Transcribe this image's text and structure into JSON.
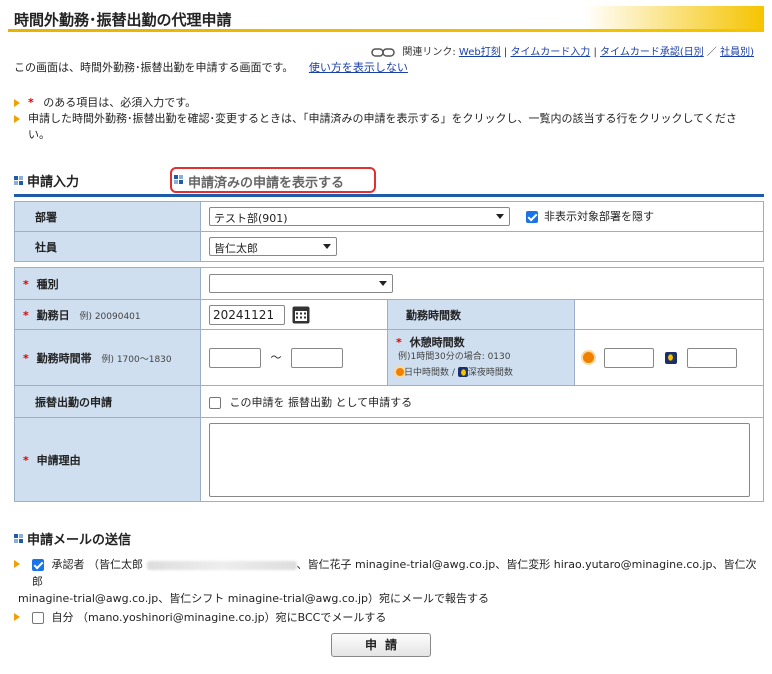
{
  "page": {
    "title": "時間外勤務･振替出勤の代理申請",
    "links_label": "関連リンク:",
    "links": [
      "Web打刻",
      "タイムカード入力",
      "タイムカード承認(日別",
      "社員別)"
    ],
    "intro": "この画面は、時間外勤務･振替出勤を申請する画面です。",
    "help_link": "使い方を表示しない",
    "note1_mark": "*",
    "note1": "のある項目は、必須入力です。",
    "note2": "申請した時間外勤務･振替出勤を確認･変更するときは、「申請済みの申請を表示する」をクリックし、一覧内の該当する行をクリックしてください。"
  },
  "tabs": {
    "input": "申請入力",
    "show_submitted": "申請済みの申請を表示する"
  },
  "form": {
    "dept_label": "部署",
    "dept_value": "テスト部(901)",
    "hide_dept_label": "非表示対象部署を隠す",
    "hide_dept_checked": true,
    "employee_label": "社員",
    "employee_value": "皆仁太郎",
    "req_mark": "*",
    "type_label": "種別",
    "type_value": "",
    "date_label": "勤務日",
    "date_example": "例) 20090401",
    "date_value": "20241121",
    "work_hours_label": "勤務時間数",
    "work_time_label": "勤務時間帯",
    "work_time_example": "例) 1700～1830",
    "tilde": "～",
    "break_label": "休憩時間数",
    "break_example": "例)1時間30分の場合: 0130",
    "break_day": "日中時間数",
    "break_night": "深夜時間数",
    "break_sep": "/",
    "substitute_label": "振替出勤の申請",
    "substitute_text": "この申請を 振替出勤 として申請する",
    "reason_label": "申請理由"
  },
  "mail": {
    "header": "申請メールの送信",
    "approver_line1": "承認者 （皆仁太郎",
    "approver_line1b": "、皆仁花子 minagine-trial@awg.co.jp、皆仁変形 hirao.yutaro@minagine.co.jp、皆仁次郎",
    "approver_line2": "minagine-trial@awg.co.jp、皆仁シフト minagine-trial@awg.co.jp）宛にメールで報告する",
    "approver_checked": true,
    "self_line": "自分 （mano.yoshinori@minagine.co.jp）宛にBCCでメールする",
    "self_checked": false
  },
  "submit_label": "申請"
}
